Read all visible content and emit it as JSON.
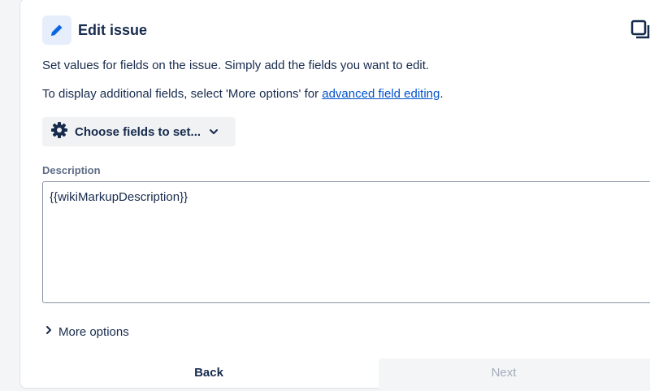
{
  "header": {
    "title": "Edit issue",
    "icon": "pencil-icon",
    "accent_color": "#0c66e4"
  },
  "intro": {
    "line1": "Set values for fields on the issue. Simply add the fields you want to edit.",
    "line2_prefix": "To display additional fields, select 'More options' for ",
    "line2_link": "advanced field editing",
    "line2_suffix": "."
  },
  "choose_fields": {
    "label": "Choose fields to set...",
    "icon": "gear-icon"
  },
  "description": {
    "label": "Description",
    "value": "{{wikiMarkupDescription}}"
  },
  "more_options": {
    "label": "More options"
  },
  "footer": {
    "back_label": "Back",
    "next_label": "Next"
  }
}
